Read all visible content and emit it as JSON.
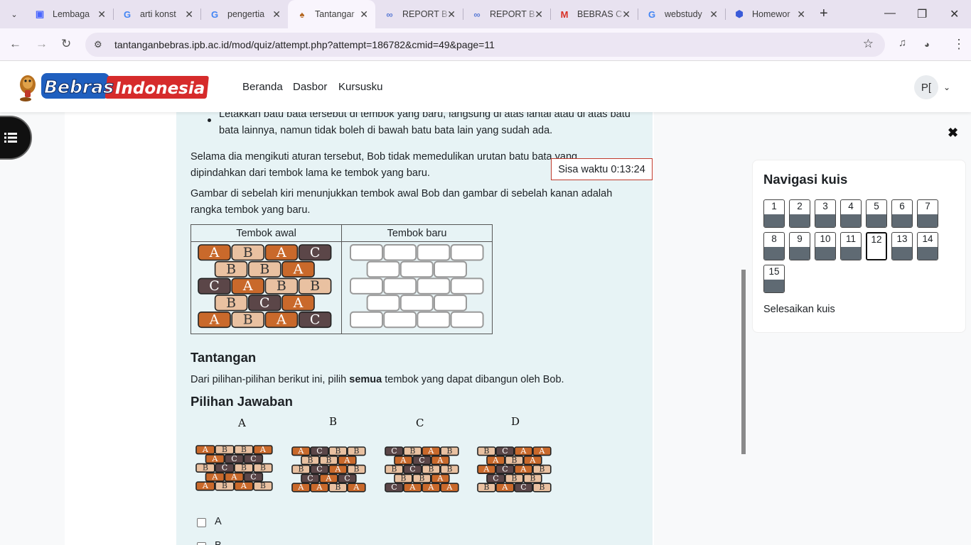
{
  "browser": {
    "tabs": [
      {
        "title": "Lembaga",
        "icon": "calendar-icon",
        "color": "#4a67ff"
      },
      {
        "title": "arti konst",
        "icon": "google-icon",
        "color": "#4285f4"
      },
      {
        "title": "pengertia",
        "icon": "google-icon",
        "color": "#4285f4"
      },
      {
        "title": "Tantangar",
        "icon": "beaver-icon",
        "color": "#b4651e"
      },
      {
        "title": "REPORT B",
        "icon": "loop-icon",
        "color": "#5b7bd5"
      },
      {
        "title": "REPORT B",
        "icon": "loop-icon",
        "color": "#5b7bd5"
      },
      {
        "title": "BEBRAS C",
        "icon": "gmail-icon",
        "color": "#d93025"
      },
      {
        "title": "webstudy",
        "icon": "google-icon",
        "color": "#4285f4"
      },
      {
        "title": "Homewor",
        "icon": "app-icon",
        "color": "#3a5bd9"
      }
    ],
    "url": "tantanganbebras.ipb.ac.id/mod/quiz/attempt.php?attempt=186782&cmid=49&page=11"
  },
  "header": {
    "logo_text": "Bebras Indonesia",
    "nav": [
      "Beranda",
      "Dasbor",
      "Kursusku"
    ],
    "avatar": "P["
  },
  "question": {
    "bullet": "Letakkan batu bata tersebut di tembok yang baru, langsung di atas lantai atau di atas batu bata lainnya, namun tidak boleh di bawah batu bata lain yang sudah ada.",
    "para1": "Selama dia mengikuti aturan tersebut, Bob tidak memedulikan urutan batu bata yang dipindahkan dari tembok lama ke tembok yang baru.",
    "para2": "Gambar di sebelah kiri menunjukkan tembok awal Bob dan gambar di sebelah kanan adalah rangka tembok yang baru.",
    "table_headers": [
      "Tembok awal",
      "Tembok baru"
    ],
    "initial_wall": [
      [
        "A",
        "B",
        "A",
        "C"
      ],
      [
        "B",
        "B",
        "A"
      ],
      [
        "C",
        "A",
        "B",
        "B"
      ],
      [
        "B",
        "C",
        "A"
      ],
      [
        "A",
        "B",
        "A",
        "C"
      ]
    ],
    "challenge_heading": "Tantangan",
    "challenge_pre": "Dari pilihan-pilihan berikut ini, pilih ",
    "challenge_bold": "semua",
    "challenge_post": " tembok yang dapat dibangun oleh Bob.",
    "options_heading": "Pilihan Jawaban",
    "options": [
      {
        "letter": "A",
        "rows": [
          [
            "A",
            "B",
            "B",
            "A"
          ],
          [
            "A",
            "C",
            "C"
          ],
          [
            "B",
            "C",
            "B",
            "B"
          ],
          [
            "A",
            "A",
            "C"
          ],
          [
            "A",
            "B",
            "A",
            "B"
          ]
        ]
      },
      {
        "letter": "B",
        "rows": [
          [
            "A",
            "C",
            "B",
            "B"
          ],
          [
            "B",
            "B",
            "A"
          ],
          [
            "B",
            "C",
            "A",
            "B"
          ],
          [
            "C",
            "A",
            "C"
          ],
          [
            "A",
            "A",
            "B",
            "A"
          ]
        ]
      },
      {
        "letter": "C",
        "rows": [
          [
            "C",
            "B",
            "A",
            "B"
          ],
          [
            "A",
            "C",
            "A"
          ],
          [
            "B",
            "C",
            "B",
            "B"
          ],
          [
            "B",
            "B",
            "A"
          ],
          [
            "C",
            "A",
            "A",
            "A"
          ]
        ]
      },
      {
        "letter": "D",
        "rows": [
          [
            "B",
            "C",
            "A",
            "A"
          ],
          [
            "A",
            "B",
            "A"
          ],
          [
            "A",
            "C",
            "A",
            "B"
          ],
          [
            "C",
            "B",
            "B"
          ],
          [
            "B",
            "A",
            "C",
            "B"
          ]
        ]
      }
    ],
    "checkbox_labels": [
      "A",
      "B"
    ]
  },
  "timer": "Sisa waktu 0:13:24",
  "quiz_nav": {
    "title": "Navigasi kuis",
    "questions": [
      1,
      2,
      3,
      4,
      5,
      6,
      7,
      8,
      9,
      10,
      11,
      12,
      13,
      14,
      15
    ],
    "current": 12,
    "finish": "Selesaikan kuis"
  },
  "colors": {
    "A": "#c9692b",
    "B": "#e9c1a1",
    "C": "#5b4648"
  }
}
